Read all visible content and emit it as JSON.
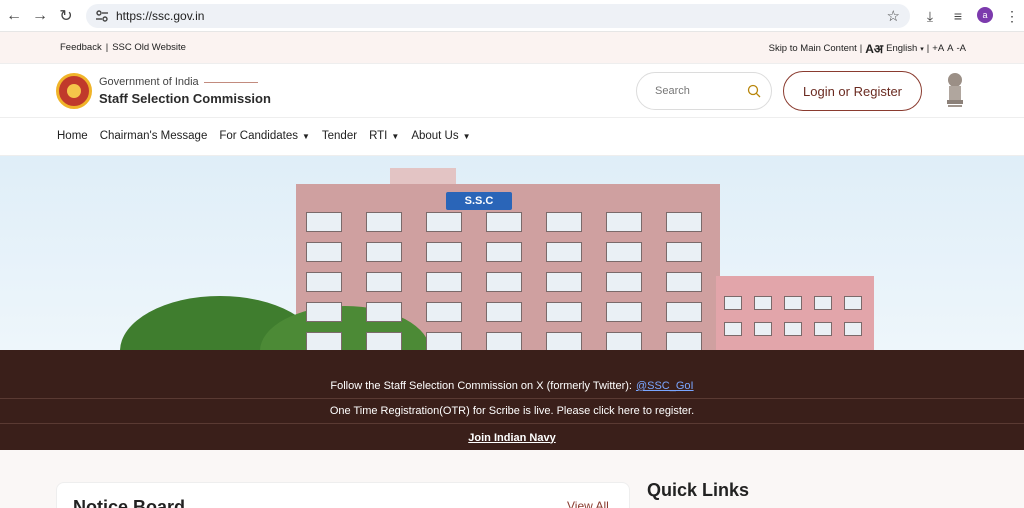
{
  "browser": {
    "url": "https://ssc.gov.in",
    "profile_initial": "a"
  },
  "topbar": {
    "feedback": "Feedback",
    "separator": "|",
    "old_site": "SSC Old Website",
    "skip": "Skip to Main Content",
    "lang_glyph": "Aअ",
    "language": "English",
    "font_inc": "+A",
    "font_normal": "A",
    "font_dec": "-A"
  },
  "header": {
    "gov": "Government of India",
    "org": "Staff Selection Commission",
    "search_placeholder": "Search",
    "login_label": "Login or Register"
  },
  "nav": {
    "items": [
      {
        "label": "Home",
        "dropdown": false
      },
      {
        "label": "Chairman's Message",
        "dropdown": false
      },
      {
        "label": "For Candidates",
        "dropdown": true
      },
      {
        "label": "Tender",
        "dropdown": false
      },
      {
        "label": "RTI",
        "dropdown": true
      },
      {
        "label": "About Us",
        "dropdown": true
      }
    ]
  },
  "hero": {
    "sign": "S.S.C"
  },
  "ticker": {
    "follow_text": "Follow the Staff Selection Commission on X (formerly Twitter):",
    "follow_handle": "@SSC_GoI",
    "otr_text": "One Time Registration(OTR) for Scribe is live. Please click here to register.",
    "navy_text": "Join Indian Navy"
  },
  "content": {
    "notice_title": "Notice Board",
    "view_all": "View All",
    "quick_links": "Quick Links"
  },
  "colors": {
    "accent": "#8a3b2f",
    "ticker_bg": "#3a1f1a",
    "topbar_bg": "#fbf3f1"
  }
}
